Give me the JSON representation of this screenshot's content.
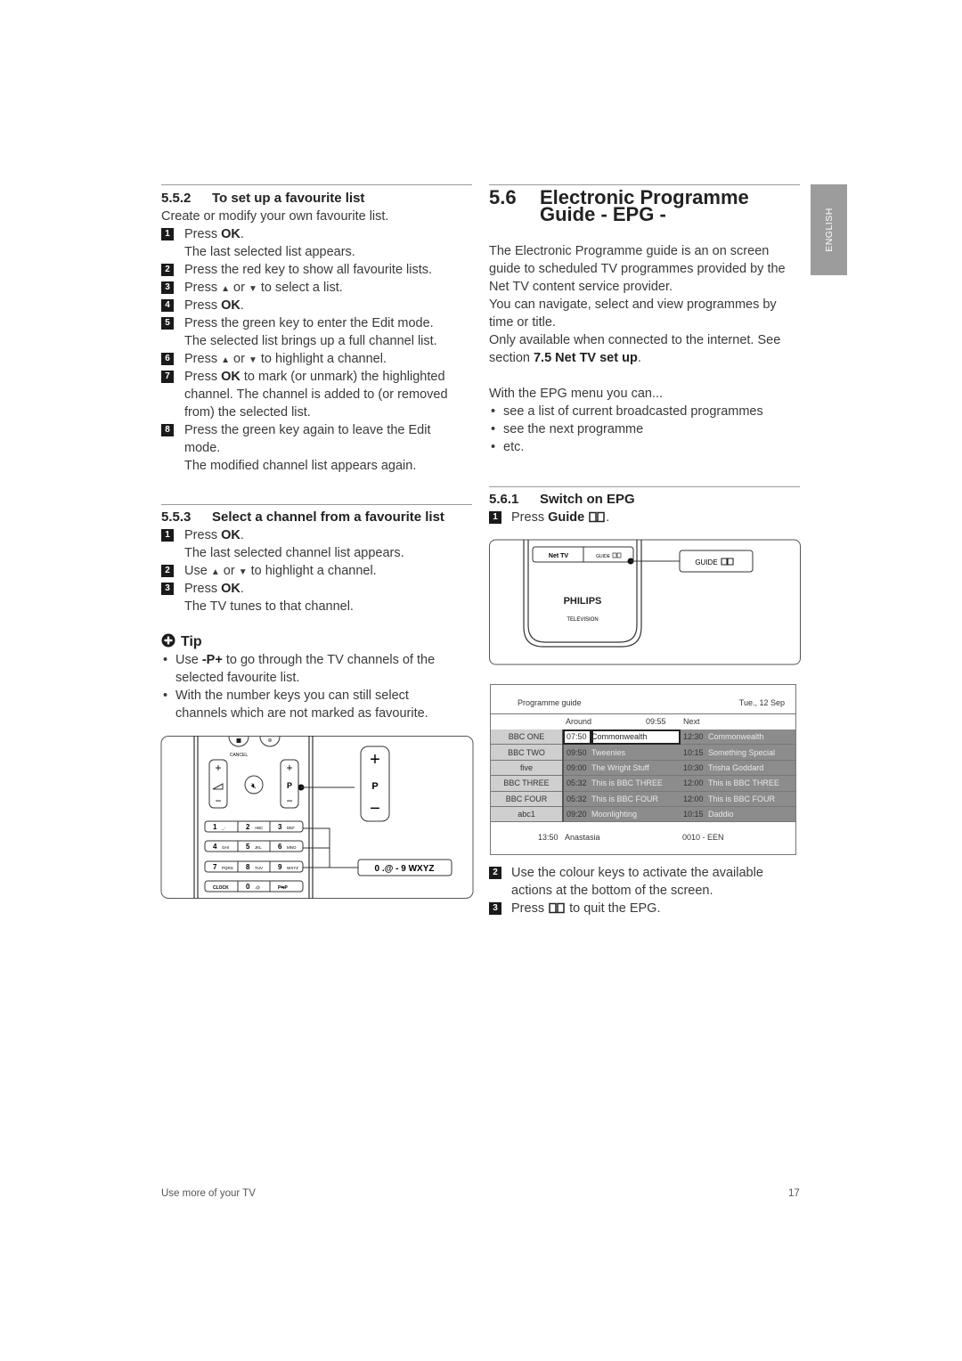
{
  "side_tab": "ENGLISH",
  "s552": {
    "number": "5.5.2",
    "title": "To set up a favourite list",
    "intro": "Create or modify your own favourite list.",
    "s1a": "Press ",
    "s1b": "OK",
    "s1c": ".",
    "s1_sub": "The last selected list appears.",
    "s2": "Press the red key to show all favourite lists.",
    "s3a": "Press ",
    "up": "▲",
    "or": " or ",
    "down": "▼",
    "s3c": " to select a list.",
    "s4a": "Press ",
    "s4b": "OK",
    "s4c": ".",
    "s5": "Press the green key to enter the Edit mode.",
    "s5_sub": "The selected list brings up a full channel list.",
    "s6a": "Press ",
    "s6c": " to highlight a channel.",
    "s7a": "Press ",
    "s7b": "OK",
    "s7c": " to mark (or unmark) the highlighted",
    "s7_l2": "channel. The channel is added to (or removed",
    "s7_l3": "from) the selected list.",
    "s8": "Press the green key again to leave the Edit",
    "s8_l2": "mode.",
    "s8_sub": "The modified channel list appears again.",
    "nums": [
      "1",
      "2",
      "3",
      "4",
      "5",
      "6",
      "7",
      "8"
    ]
  },
  "s553": {
    "number": "5.5.3",
    "title": "Select a channel from a favourite list",
    "s1a": "Press ",
    "s1b": "OK",
    "s1c": ".",
    "s1_sub": "The last selected channel list appears.",
    "s2a": "Use ",
    "s2c": " to highlight a channel.",
    "s3a": "Press ",
    "s3b": "OK",
    "s3c": ".",
    "s3_sub": "The TV tunes to that channel."
  },
  "tip": {
    "title": "Tip",
    "b1a": "Use ",
    "b1b": "-P+",
    "b1c": " to go through the TV channels of the",
    "b1_l2": "selected favourite list.",
    "b2": "With the number keys you can still select",
    "b2_l2": "channels which are not marked as favourite."
  },
  "remote1": {
    "cancel": "CANCEL",
    "plus": "+",
    "minus": "−",
    "p": "P",
    "keys": [
      [
        "1",
        "_-"
      ],
      [
        "2",
        "ABC"
      ],
      [
        "3",
        "DEF"
      ],
      [
        "4",
        "GHI"
      ],
      [
        "5",
        "JKL"
      ],
      [
        "6",
        "MNO"
      ],
      [
        "7",
        "PQRS"
      ],
      [
        "8",
        "TUV"
      ],
      [
        "9",
        "WXYZ"
      ],
      [
        "CLOCK",
        ""
      ],
      [
        "0",
        ".@"
      ],
      [
        "P⇆P",
        ""
      ]
    ],
    "callout": "0 .@  -  9 WXYZ"
  },
  "s56": {
    "number": "5.6",
    "title_l1": "Electronic Programme",
    "title_l2": "Guide - EPG -",
    "p1": "The Electronic Programme guide is an on screen",
    "p2": "guide to scheduled TV programmes provided by the",
    "p3": "Net TV content service provider.",
    "p4": "You can navigate, select and view programmes by",
    "p5": "time or title.",
    "p6": "Only available when connected to the internet. See",
    "p7a": "section ",
    "p7b": "7.5 Net TV set up",
    "p7c": ".",
    "menu_intro": "With the EPG menu you can...",
    "bullets": [
      "see a list of current broadcasted programmes",
      "see the next programme",
      "etc."
    ]
  },
  "s561": {
    "number": "5.6.1",
    "title": "Switch on EPG",
    "s1a": "Press ",
    "s1b": "Guide",
    "s1c": ".",
    "s2": "Use the colour keys to activate the available",
    "s2_l2": "actions at the bottom of the screen.",
    "s3a": "Press ",
    "s3c": " to quit the EPG."
  },
  "remote2": {
    "nettv": "Net TV",
    "guide": "GUIDE",
    "brand": "PHILIPS",
    "brand_sub": "TELEVISION",
    "callout": "GUIDE"
  },
  "epg": {
    "title": "Programme guide",
    "date": "Tue., 12 Sep",
    "around": "Around",
    "now": "09:55",
    "next": "Next",
    "rows": [
      {
        "ch": "BBC ONE",
        "t1": "07:50",
        "p1": "Commonwealth",
        "t2": "12:30",
        "p2": "Commonwealth"
      },
      {
        "ch": "BBC TWO",
        "t1": "09:50",
        "p1": "Tweenies",
        "t2": "10:15",
        "p2": "Something Special"
      },
      {
        "ch": "five",
        "t1": "09:00",
        "p1": "The Wright Stuff",
        "t2": "10:30",
        "p2": "Trisha Goddard"
      },
      {
        "ch": "BBC THREE",
        "t1": "05:32",
        "p1": "This is BBC THREE",
        "t2": "12:00",
        "p2": "This is BBC THREE"
      },
      {
        "ch": "BBC FOUR",
        "t1": "05:32",
        "p1": "This is BBC FOUR",
        "t2": "12:00",
        "p2": "This is BBC FOUR"
      },
      {
        "ch": "abc1",
        "t1": "09:20",
        "p1": "Moonlighting",
        "t2": "10:15",
        "p2": "Daddio"
      }
    ],
    "footer_time": "13:50",
    "footer_title": "Anastasia",
    "footer_channel": "0010 - EEN"
  },
  "footer": {
    "left": "Use more of your TV",
    "page": "17"
  }
}
